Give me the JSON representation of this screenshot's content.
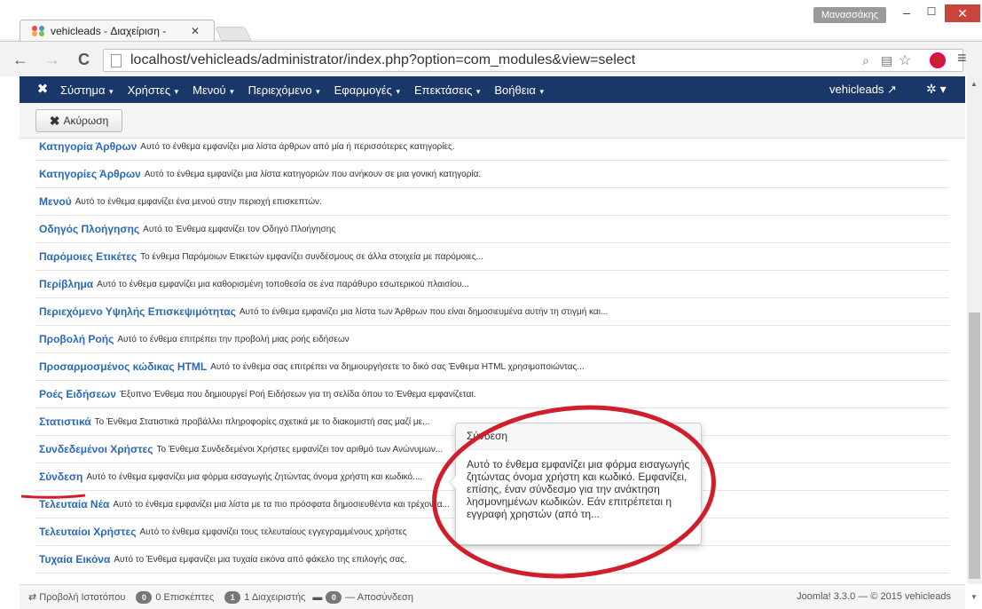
{
  "browser": {
    "tab_title": "vehicleads - Διαχείριση - ",
    "tab_close": "✕",
    "user_name": "Μανασσάκης",
    "win_min": "–",
    "win_max": "☐",
    "win_close": "✕",
    "url": "localhost/vehicleads/administrator/index.php?option=com_modules&view=select",
    "back_icon": "←",
    "forward_icon": "→",
    "reload_icon": "C",
    "star_icon": "☆",
    "menu_icon": "≡"
  },
  "nav": {
    "items": [
      "Σύστημα",
      "Χρήστες",
      "Μενού",
      "Περιεχόμενο",
      "Εφαρμογές",
      "Επεκτάσεις",
      "Βοήθεια"
    ],
    "site": "vehicleads ↗",
    "gear": "✲ ▾"
  },
  "toolbar": {
    "cancel_label": "Ακύρωση"
  },
  "modules": [
    {
      "name": "Κατηγορία Άρθρων",
      "desc": "Αυτό το ένθεμα εμφανίζει μια λίστα άρθρων από μία ή περισσότερες κατηγορίες."
    },
    {
      "name": "Κατηγορίες Άρθρων",
      "desc": "Αυτό το ένθεμα εμφανίζει μια λίστα κατηγοριών που ανήκουν σε μια γονική κατηγορία."
    },
    {
      "name": "Μενού",
      "desc": "Αυτό το ένθεμα εμφανίζει ένα μενού στην περιοχή επισκεπτών."
    },
    {
      "name": "Οδηγός Πλοήγησης",
      "desc": "Αυτό το Ένθεμα εμφανίζει τον Οδηγό Πλοήγησης"
    },
    {
      "name": "Παρόμοιες Ετικέτες",
      "desc": "Το ένθεμα Παρόμοιων Ετικετών εμφανίζει συνδέσμους σε άλλα στοιχεία με παρόμοιες..."
    },
    {
      "name": "Περίβλημα",
      "desc": "Αυτό το ένθεμα εμφανίζει μια καθορισμένη τοποθεσία σε ένα παράθυρο εσωτερικού πλαισίου..."
    },
    {
      "name": "Περιεχόμενο Υψηλής Επισκεψιμότητας",
      "desc": "Αυτό το ένθεμα εμφανίζει μια λίστα των Άρθρων που είναι δημοσιευμένα αυτήν τη στιγμή και..."
    },
    {
      "name": "Προβολή Ροής",
      "desc": "Αυτό το ένθεμα επιτρέπει την προβολή μιας ροής ειδήσεων"
    },
    {
      "name": "Προσαρμοσμένος κώδικας HTML",
      "desc": "Αυτό το ένθεμα σας επιτρέπει να δημιουργήσετε το δικό σας Ένθεμα HTML χρησιμοποιώντας..."
    },
    {
      "name": "Ροές Ειδήσεων",
      "desc": "Έξυπνο Ένθεμα που δημιουργεί Ροή Ειδήσεων για τη σελίδα όπου το Ένθεμα εμφανίζεται."
    },
    {
      "name": "Στατιστικά",
      "desc": "Το Ένθεμα Στατιστικά προβάλλει πληροφορίες σχετικά με το διακομιστή σας μαζί με..."
    },
    {
      "name": "Συνδεδεμένοι Χρήστες",
      "desc": "Το Ένθεμα Συνδεδεμένοι Χρήστες εμφανίζει τον αριθμό των Ανώνυμων..."
    },
    {
      "name": "Σύνδεση",
      "desc": "Αυτό το ένθεμα εμφανίζει μια φόρμα εισαγωγής ζητώντας όνομα χρήστη και κωδικό...."
    },
    {
      "name": "Τελευταία Νέα",
      "desc": "Αυτό το ένθεμα εμφανίζει μια λίστα με τα πιο πρόσφατα δημοσιευθέντα και τρέχοντα..."
    },
    {
      "name": "Τελευταίοι Χρήστες",
      "desc": "Αυτό το ένθεμα εμφανίζει τους τελευταίους εγγεγραμμένους χρήστες"
    },
    {
      "name": "Τυχαία Εικόνα",
      "desc": "Αυτό το Ένθεμα εμφανίζει μια τυχαία εικόνα από φάκελο της επιλογής σας."
    }
  ],
  "popover": {
    "title": "Σύνδεση",
    "body": "Αυτό το ένθεμα εμφανίζει μια φόρμα εισαγωγής ζητώντας όνομα χρήστη και κωδικό. Εμφανίζει, επίσης, έναν σύνδεσμο για την ανάκτηση λησμονημένων κωδικών. Εάν επιτρέπεται η εγγραφή χρηστών (από τη..."
  },
  "status": {
    "view_site": "⇄ Προβολή Ιστοτόπου",
    "visitors_count": "0",
    "visitors_label": "0 Επισκέπτες",
    "admins_count": "1",
    "admins_label": "1 Διαχειριστής",
    "messages_count": "0",
    "logout": "— Αποσύνδεση",
    "version": "Joomla! 3.3.0 — © 2015 vehicleads"
  },
  "colors": {
    "navbar": "#1a3867",
    "link": "#2a69b8",
    "annotation": "#d01e2a"
  }
}
